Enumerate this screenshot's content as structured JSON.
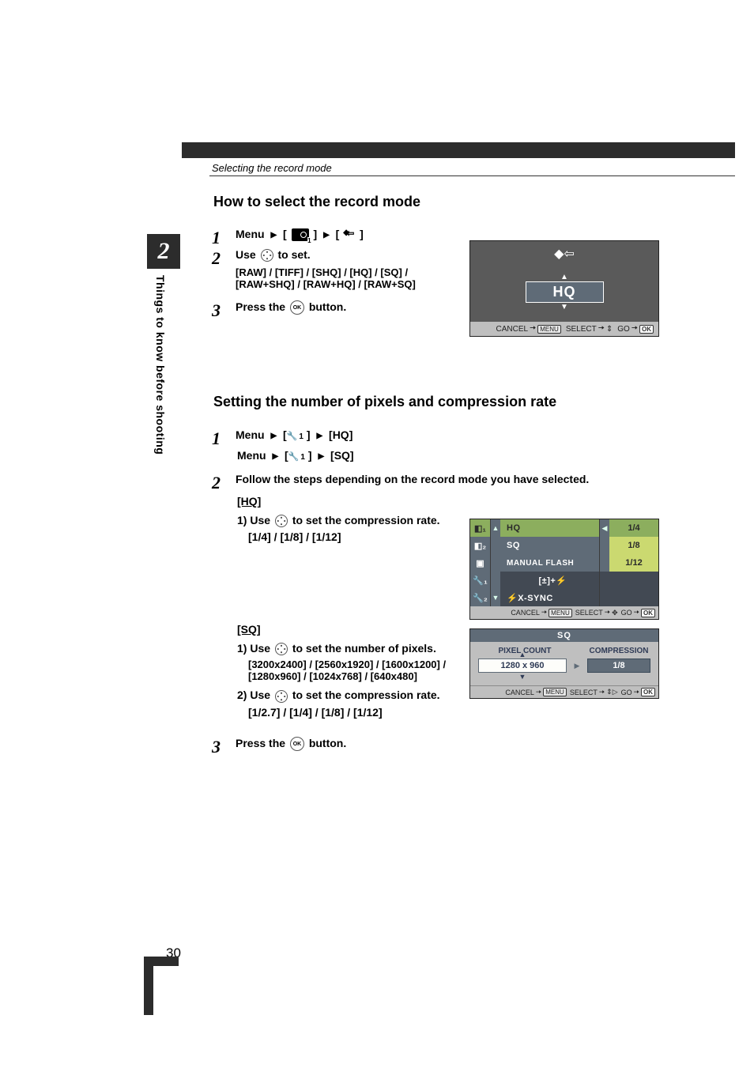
{
  "breadcrumb": "Selecting the record mode",
  "chapter_number": "2",
  "side_text": "Things to know before shooting",
  "page_number": "30",
  "heading1": "How to select the record mode",
  "heading2": "Setting the number of pixels and compression rate",
  "sec1": {
    "step1_pre": "Menu",
    "step2_main": "Use",
    "step2_post": "to set.",
    "step2_options": "[RAW] / [TIFF] / [SHQ] / [HQ] / [SQ] / [RAW+SHQ] / [RAW+HQ] / [RAW+SQ]",
    "step3_pre": "Press the",
    "step3_post": "button."
  },
  "sec2": {
    "step1a_pre": "Menu",
    "step1a_mid": "[",
    "step1a_suffix": "]",
    "step1a_end": "[HQ]",
    "step1b_pre": "Menu",
    "step1b_end": "[SQ]",
    "step2": "Follow the steps depending on the record mode you have selected.",
    "hq_label": "[HQ]",
    "hq_line1_a": "1) Use",
    "hq_line1_b": "to set the compression rate.",
    "hq_line2": "[1/4] / [1/8] / [1/12]",
    "sq_label": "[SQ]",
    "sq_line1_a": "1) Use",
    "sq_line1_b": "to set the number of pixels.",
    "sq_line2": "[3200x2400] / [2560x1920] / [1600x1200] / [1280x960] / [1024x768] / [640x480]",
    "sq_line3_a": "2) Use",
    "sq_line3_b": "to set the compression rate.",
    "sq_line4": "[1/2.7] / [1/4] / [1/8] / [1/12]",
    "step3_pre": "Press the",
    "step3_post": "button."
  },
  "screen1": {
    "value": "HQ",
    "cancel": "CANCEL",
    "menu_key": "MENU",
    "select": "SELECT",
    "go": "GO",
    "ok": "OK"
  },
  "screen2": {
    "rows": [
      {
        "label": "HQ",
        "val": "1/4",
        "sel": true
      },
      {
        "label": "SQ",
        "val": "1/8"
      },
      {
        "label": "MANUAL FLASH",
        "val": "1/12"
      },
      {
        "label": "[±]+⚡",
        "val": ""
      },
      {
        "label": "⚡X-SYNC",
        "val": ""
      }
    ],
    "tab1": "◧₁",
    "tab2": "◧₂",
    "tab3": "▣",
    "tab4": "🔧₁",
    "tab5": "🔧₂",
    "cancel": "CANCEL",
    "menu_key": "MENU",
    "select": "SELECT",
    "go": "GO",
    "ok": "OK"
  },
  "screen3": {
    "title": "SQ",
    "col1": "PIXEL COUNT",
    "col2": "COMPRESSION",
    "pix": "1280 x 960",
    "comp": "1/8",
    "cancel": "CANCEL",
    "menu_key": "MENU",
    "select": "SELECT",
    "go": "GO",
    "ok": "OK"
  }
}
